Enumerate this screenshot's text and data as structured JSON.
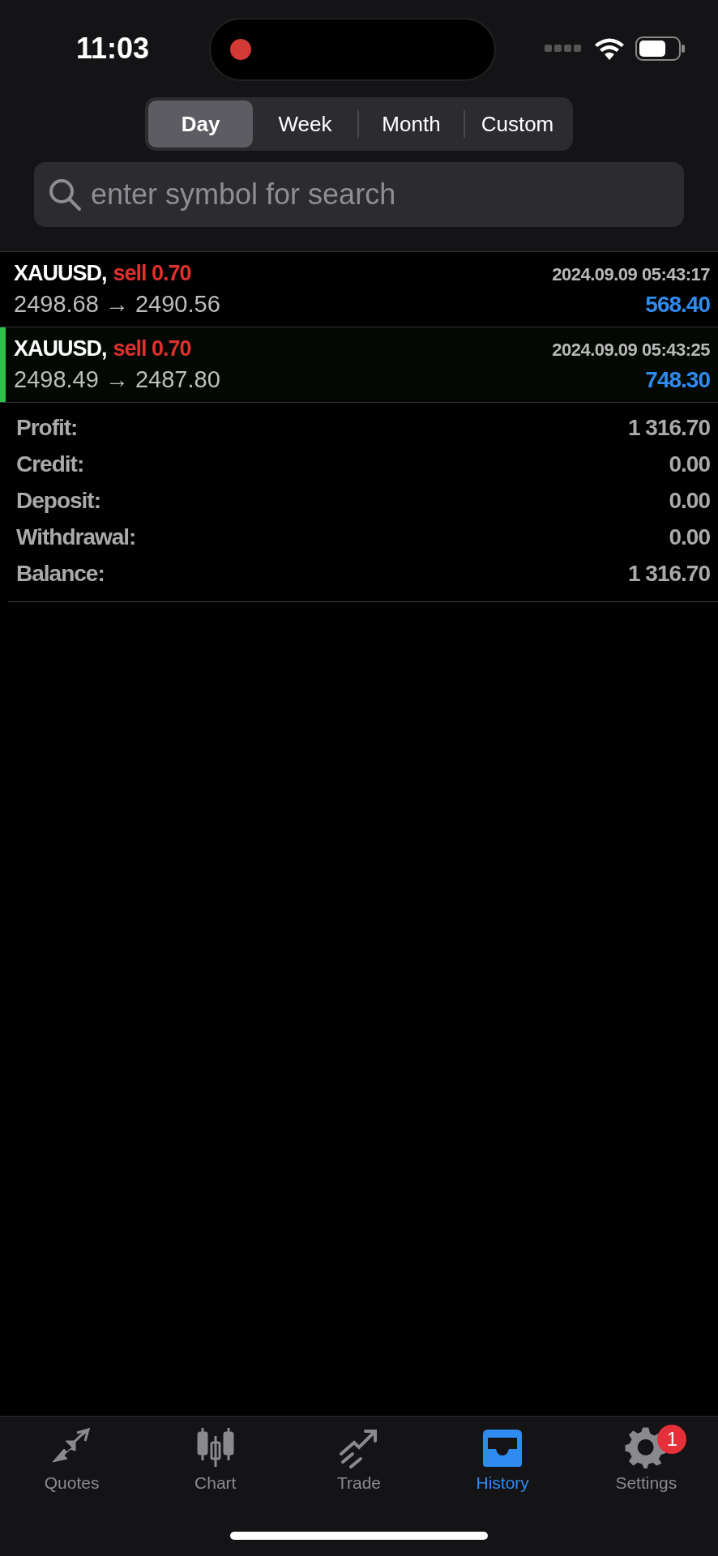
{
  "status_bar": {
    "time": "11:03",
    "recording": true
  },
  "period_tabs": [
    {
      "label": "Day",
      "selected": true
    },
    {
      "label": "Week",
      "selected": false
    },
    {
      "label": "Month",
      "selected": false
    },
    {
      "label": "Custom",
      "selected": false
    }
  ],
  "search": {
    "placeholder": "enter symbol for search"
  },
  "deals": [
    {
      "symbol": "XAUUSD,",
      "side": "sell 0.70",
      "time": "2024.09.09 05:43:17",
      "prices": "2498.68 → 2490.56",
      "profit": "568.40",
      "selected": false
    },
    {
      "symbol": "XAUUSD,",
      "side": "sell 0.70",
      "time": "2024.09.09 05:43:25",
      "prices": "2498.49 → 2487.80",
      "profit": "748.30",
      "selected": true
    }
  ],
  "summary": [
    {
      "label": "Profit:",
      "value": "1 316.70"
    },
    {
      "label": "Credit:",
      "value": "0.00"
    },
    {
      "label": "Deposit:",
      "value": "0.00"
    },
    {
      "label": "Withdrawal:",
      "value": "0.00"
    },
    {
      "label": "Balance:",
      "value": "1 316.70"
    }
  ],
  "tab_bar": [
    {
      "kind": "quotes",
      "label": "Quotes",
      "selected": false
    },
    {
      "kind": "chart",
      "label": "Chart",
      "selected": false
    },
    {
      "kind": "trade",
      "label": "Trade",
      "selected": false
    },
    {
      "kind": "history",
      "label": "History",
      "selected": true
    },
    {
      "kind": "settings",
      "label": "Settings",
      "selected": false,
      "badge": "1"
    }
  ]
}
